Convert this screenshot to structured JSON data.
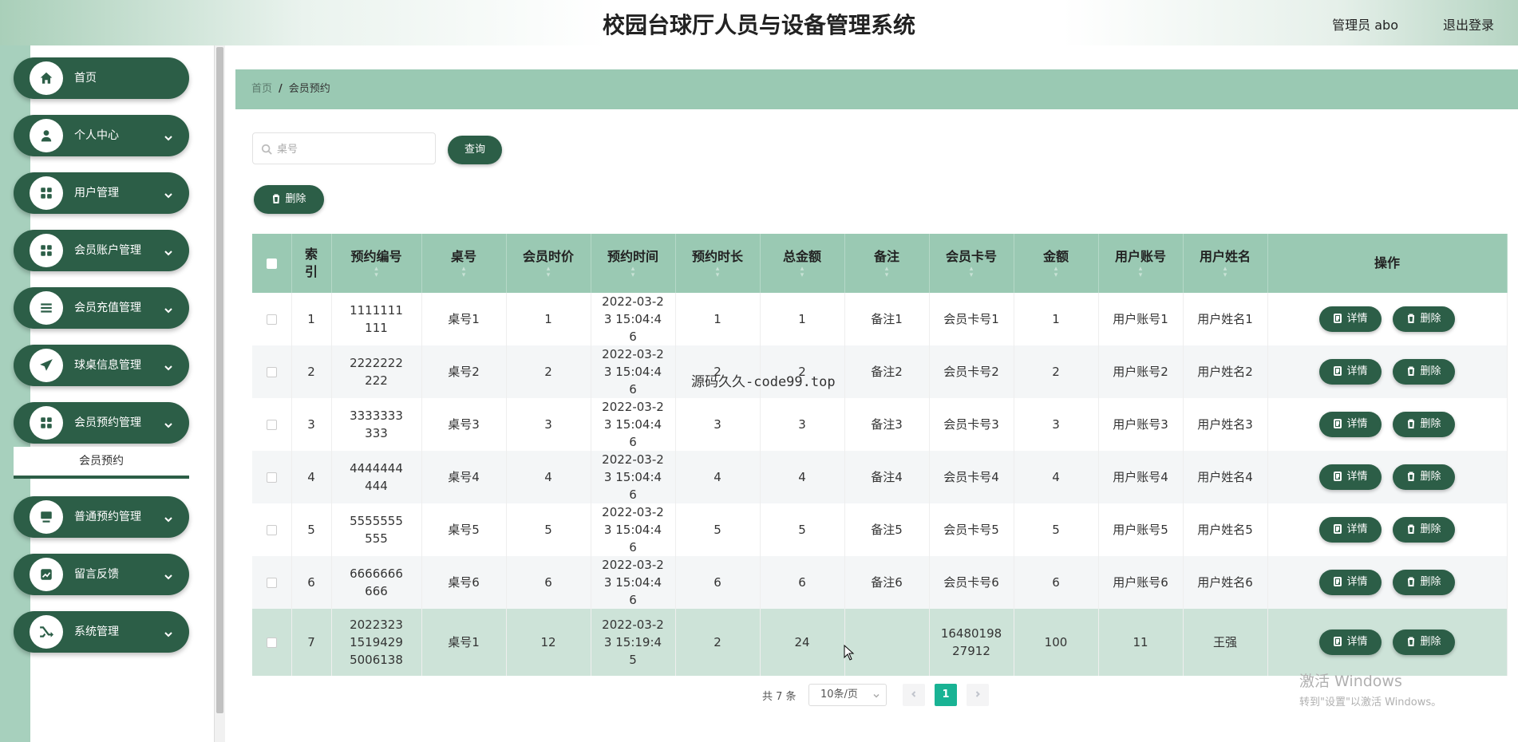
{
  "header": {
    "title": "校园台球厅人员与设备管理系统",
    "user": "管理员 abo",
    "logout": "退出登录"
  },
  "sidebar": {
    "items": [
      {
        "label": "首页",
        "icon": "home-icon",
        "has_children": false
      },
      {
        "label": "个人中心",
        "icon": "user-icon",
        "has_children": true
      },
      {
        "label": "用户管理",
        "icon": "grid-icon",
        "has_children": true
      },
      {
        "label": "会员账户管理",
        "icon": "grid-icon",
        "has_children": true
      },
      {
        "label": "会员充值管理",
        "icon": "list-icon",
        "has_children": true
      },
      {
        "label": "球桌信息管理",
        "icon": "send-icon",
        "has_children": true
      },
      {
        "label": "会员预约管理",
        "icon": "grid-icon",
        "has_children": true
      },
      {
        "label": "普通预约管理",
        "icon": "monitor-icon",
        "has_children": true
      },
      {
        "label": "留言反馈",
        "icon": "chart-icon",
        "has_children": true
      },
      {
        "label": "系统管理",
        "icon": "shuffle-icon",
        "has_children": true
      }
    ],
    "active_submenu": "会员预约"
  },
  "breadcrumb": {
    "home": "首页",
    "separator": "/",
    "current": "会员预约"
  },
  "search": {
    "placeholder": "桌号",
    "value": "",
    "query_label": "查询"
  },
  "toolbar": {
    "batch_delete_label": "删除"
  },
  "table": {
    "headers": [
      "索引",
      "预约编号",
      "桌号",
      "会员时价",
      "预约时间",
      "预约时长",
      "总金额",
      "备注",
      "会员卡号",
      "金额",
      "用户账号",
      "用户姓名",
      "操作"
    ],
    "rows": [
      {
        "idx": "1",
        "no": "1111111111",
        "table_no": "桌号1",
        "price": "1",
        "time": "2022-03-23 15:04:46",
        "duration": "1",
        "total": "1",
        "remark": "备注1",
        "card": "会员卡号1",
        "amount": "1",
        "account": "用户账号1",
        "name": "用户姓名1"
      },
      {
        "idx": "2",
        "no": "2222222222",
        "table_no": "桌号2",
        "price": "2",
        "time": "2022-03-23 15:04:46",
        "duration": "2",
        "total": "2",
        "remark": "备注2",
        "card": "会员卡号2",
        "amount": "2",
        "account": "用户账号2",
        "name": "用户姓名2"
      },
      {
        "idx": "3",
        "no": "3333333333",
        "table_no": "桌号3",
        "price": "3",
        "time": "2022-03-23 15:04:46",
        "duration": "3",
        "total": "3",
        "remark": "备注3",
        "card": "会员卡号3",
        "amount": "3",
        "account": "用户账号3",
        "name": "用户姓名3"
      },
      {
        "idx": "4",
        "no": "4444444444",
        "table_no": "桌号4",
        "price": "4",
        "time": "2022-03-23 15:04:46",
        "duration": "4",
        "total": "4",
        "remark": "备注4",
        "card": "会员卡号4",
        "amount": "4",
        "account": "用户账号4",
        "name": "用户姓名4"
      },
      {
        "idx": "5",
        "no": "5555555555",
        "table_no": "桌号5",
        "price": "5",
        "time": "2022-03-23 15:04:46",
        "duration": "5",
        "total": "5",
        "remark": "备注5",
        "card": "会员卡号5",
        "amount": "5",
        "account": "用户账号5",
        "name": "用户姓名5"
      },
      {
        "idx": "6",
        "no": "6666666666",
        "table_no": "桌号6",
        "price": "6",
        "time": "2022-03-23 15:04:46",
        "duration": "6",
        "total": "6",
        "remark": "备注6",
        "card": "会员卡号6",
        "amount": "6",
        "account": "用户账号6",
        "name": "用户姓名6"
      },
      {
        "idx": "7",
        "no": "202232315194295006138",
        "table_no": "桌号1",
        "price": "12",
        "time": "2022-03-23 15:19:45",
        "duration": "2",
        "total": "24",
        "remark": "",
        "card": "1648019827912",
        "amount": "100",
        "account": "11",
        "name": "王强"
      }
    ],
    "detail_label": "详情",
    "delete_label": "删除"
  },
  "pagination": {
    "total": "共 7 条",
    "page_size": "10条/页",
    "current_page": "1"
  },
  "overlay": {
    "watermark_center": "源码久久-code99.top",
    "windows_line1": "激活 Windows",
    "windows_line2": "转到\"设置\"以激活 Windows。"
  },
  "colors": {
    "primary": "#2c5e47",
    "header_row": "#9ac9b3",
    "sidebar_stripe": "#a7d0bd",
    "highlight_row": "#cde3d8",
    "pager_active": "#19b394"
  }
}
